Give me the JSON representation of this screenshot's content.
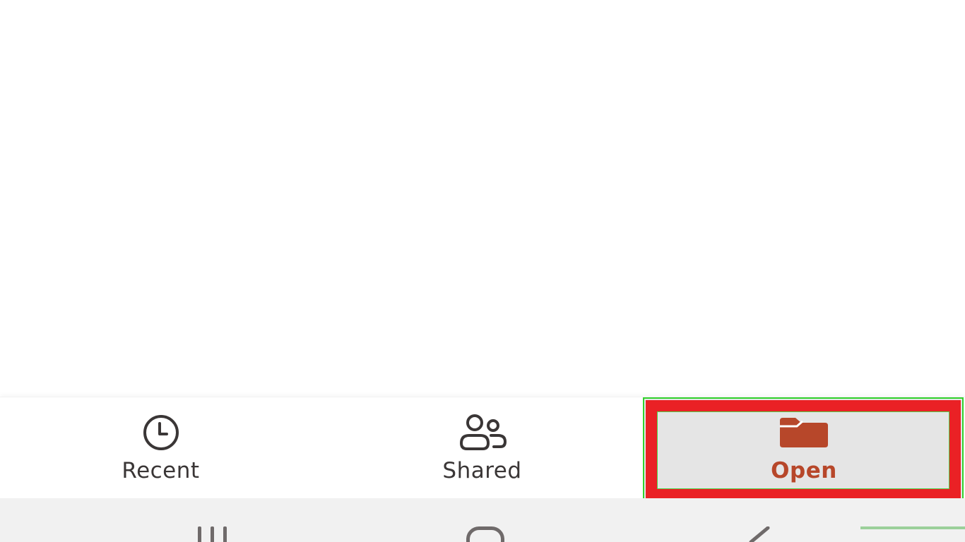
{
  "nav": {
    "items": [
      {
        "id": "recent",
        "label": "Recent",
        "icon": "clock-icon"
      },
      {
        "id": "shared",
        "label": "Shared",
        "icon": "people-icon"
      },
      {
        "id": "open",
        "label": "Open",
        "icon": "folder-icon",
        "selected": true
      }
    ]
  },
  "system_nav": {
    "icons": [
      "recent-apps-icon",
      "home-icon",
      "back-icon"
    ]
  },
  "colors": {
    "accent": "#b7472a",
    "label": "#3a3636",
    "selected_bg": "#e5e5e5",
    "highlight_red": "#ea2125",
    "highlight_green": "#31d22c",
    "system_bar_bg": "#f1f1f1"
  }
}
